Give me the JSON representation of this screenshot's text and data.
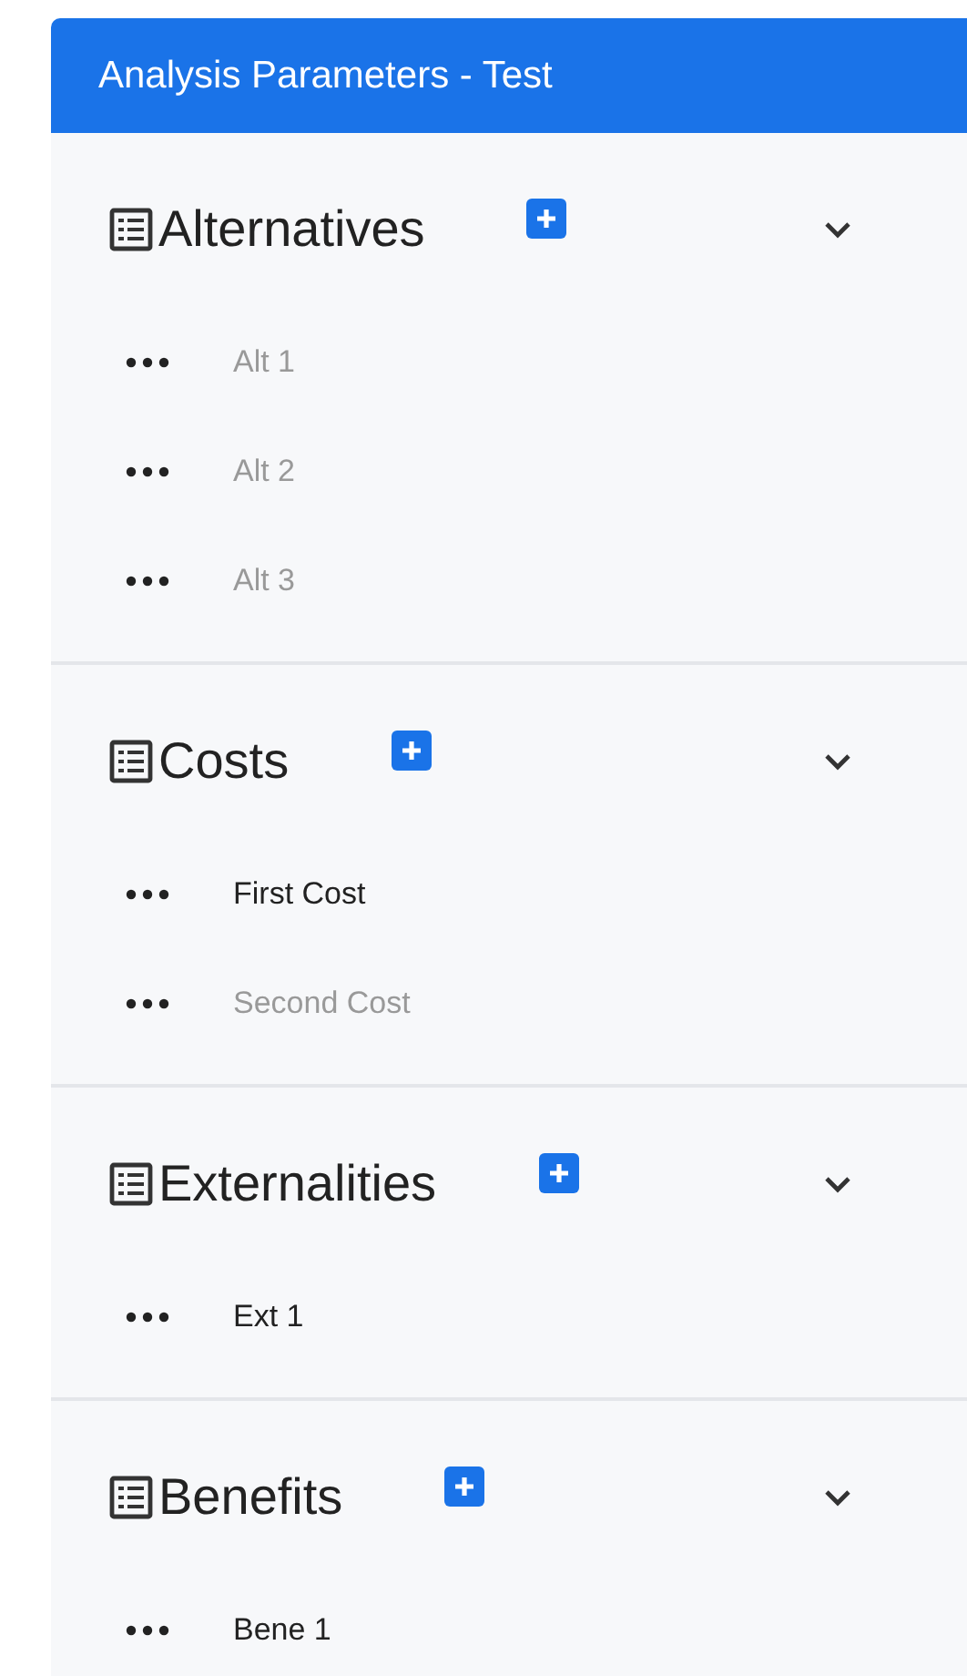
{
  "panel": {
    "title": "Analysis Parameters - Test"
  },
  "sections": [
    {
      "title": "Alternatives",
      "expanded": true,
      "items": [
        {
          "label": "Alt 1",
          "active": false
        },
        {
          "label": "Alt 2",
          "active": false
        },
        {
          "label": "Alt 3",
          "active": false
        }
      ]
    },
    {
      "title": "Costs",
      "expanded": true,
      "items": [
        {
          "label": "First Cost",
          "active": true
        },
        {
          "label": "Second Cost",
          "active": false
        }
      ]
    },
    {
      "title": "Externalities",
      "expanded": true,
      "items": [
        {
          "label": "Ext 1",
          "active": true
        }
      ]
    },
    {
      "title": "Benefits",
      "expanded": true,
      "items": [
        {
          "label": "Bene 1",
          "active": true
        }
      ]
    }
  ]
}
